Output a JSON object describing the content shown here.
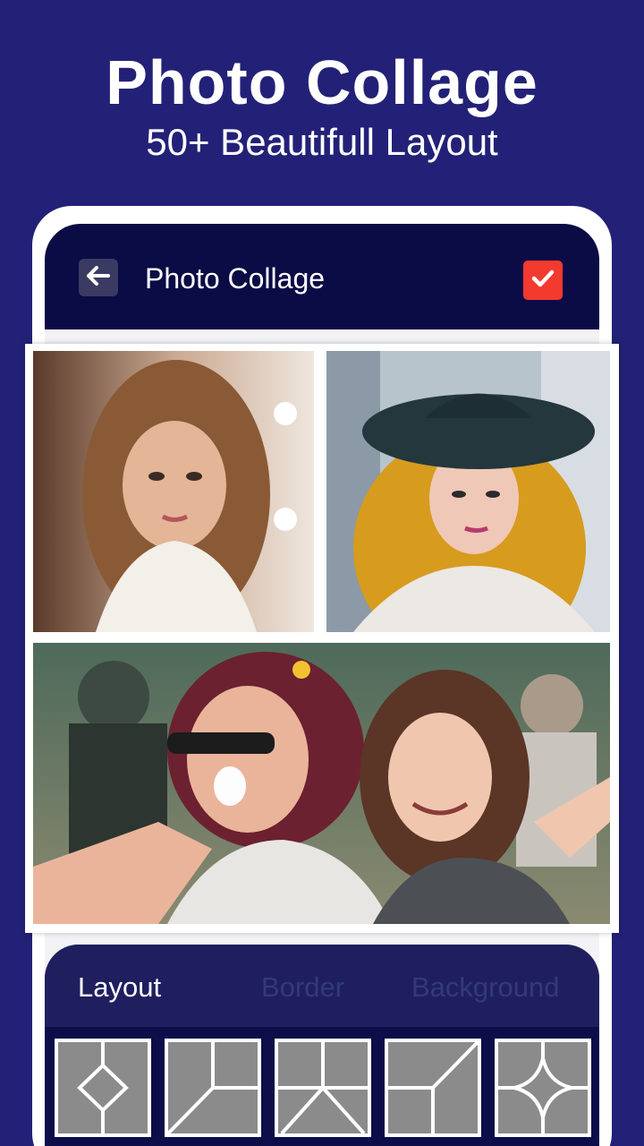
{
  "promo": {
    "title": "Photo Collage",
    "subtitle": "50+ Beautifull Layout"
  },
  "app_bar": {
    "title": "Photo Collage",
    "back_icon": "arrow-left-icon",
    "confirm_icon": "checkmark-icon"
  },
  "collage": {
    "photos": [
      {
        "label": "woman-long-wavy-hair-portrait"
      },
      {
        "label": "woman-black-hat-yellow-hair"
      },
      {
        "label": "woman-and-girl-smiling-festival"
      }
    ]
  },
  "panel": {
    "tabs": [
      {
        "label": "Layout",
        "active": true
      },
      {
        "label": "Border",
        "active": false
      },
      {
        "label": "Background",
        "active": false
      }
    ],
    "layouts": [
      "diamond-center",
      "split-angled",
      "v-split",
      "diagonal-split",
      "star-center"
    ]
  },
  "colors": {
    "background": "#232177",
    "app_bar": "#0b0b45",
    "confirm": "#f23a2f",
    "tab_active": "#ffffff",
    "tab_inactive": "#333a78",
    "layout_cell": "#8b8b8b"
  }
}
